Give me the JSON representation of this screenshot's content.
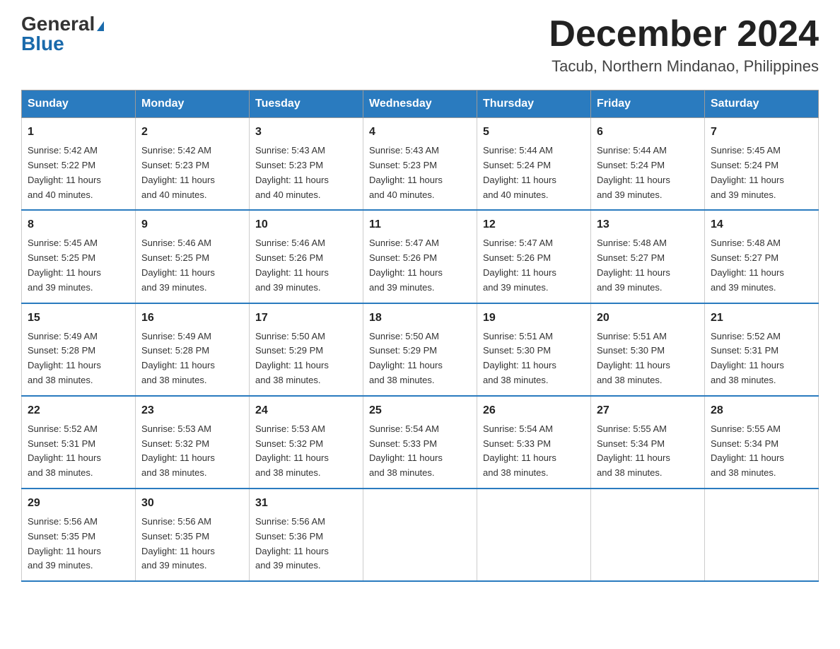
{
  "header": {
    "logo_general": "General",
    "logo_blue": "Blue",
    "month_title": "December 2024",
    "location": "Tacub, Northern Mindanao, Philippines"
  },
  "days_of_week": [
    "Sunday",
    "Monday",
    "Tuesday",
    "Wednesday",
    "Thursday",
    "Friday",
    "Saturday"
  ],
  "weeks": [
    [
      {
        "day": "1",
        "sunrise": "5:42 AM",
        "sunset": "5:22 PM",
        "daylight": "11 hours and 40 minutes."
      },
      {
        "day": "2",
        "sunrise": "5:42 AM",
        "sunset": "5:23 PM",
        "daylight": "11 hours and 40 minutes."
      },
      {
        "day": "3",
        "sunrise": "5:43 AM",
        "sunset": "5:23 PM",
        "daylight": "11 hours and 40 minutes."
      },
      {
        "day": "4",
        "sunrise": "5:43 AM",
        "sunset": "5:23 PM",
        "daylight": "11 hours and 40 minutes."
      },
      {
        "day": "5",
        "sunrise": "5:44 AM",
        "sunset": "5:24 PM",
        "daylight": "11 hours and 40 minutes."
      },
      {
        "day": "6",
        "sunrise": "5:44 AM",
        "sunset": "5:24 PM",
        "daylight": "11 hours and 39 minutes."
      },
      {
        "day": "7",
        "sunrise": "5:45 AM",
        "sunset": "5:24 PM",
        "daylight": "11 hours and 39 minutes."
      }
    ],
    [
      {
        "day": "8",
        "sunrise": "5:45 AM",
        "sunset": "5:25 PM",
        "daylight": "11 hours and 39 minutes."
      },
      {
        "day": "9",
        "sunrise": "5:46 AM",
        "sunset": "5:25 PM",
        "daylight": "11 hours and 39 minutes."
      },
      {
        "day": "10",
        "sunrise": "5:46 AM",
        "sunset": "5:26 PM",
        "daylight": "11 hours and 39 minutes."
      },
      {
        "day": "11",
        "sunrise": "5:47 AM",
        "sunset": "5:26 PM",
        "daylight": "11 hours and 39 minutes."
      },
      {
        "day": "12",
        "sunrise": "5:47 AM",
        "sunset": "5:26 PM",
        "daylight": "11 hours and 39 minutes."
      },
      {
        "day": "13",
        "sunrise": "5:48 AM",
        "sunset": "5:27 PM",
        "daylight": "11 hours and 39 minutes."
      },
      {
        "day": "14",
        "sunrise": "5:48 AM",
        "sunset": "5:27 PM",
        "daylight": "11 hours and 39 minutes."
      }
    ],
    [
      {
        "day": "15",
        "sunrise": "5:49 AM",
        "sunset": "5:28 PM",
        "daylight": "11 hours and 38 minutes."
      },
      {
        "day": "16",
        "sunrise": "5:49 AM",
        "sunset": "5:28 PM",
        "daylight": "11 hours and 38 minutes."
      },
      {
        "day": "17",
        "sunrise": "5:50 AM",
        "sunset": "5:29 PM",
        "daylight": "11 hours and 38 minutes."
      },
      {
        "day": "18",
        "sunrise": "5:50 AM",
        "sunset": "5:29 PM",
        "daylight": "11 hours and 38 minutes."
      },
      {
        "day": "19",
        "sunrise": "5:51 AM",
        "sunset": "5:30 PM",
        "daylight": "11 hours and 38 minutes."
      },
      {
        "day": "20",
        "sunrise": "5:51 AM",
        "sunset": "5:30 PM",
        "daylight": "11 hours and 38 minutes."
      },
      {
        "day": "21",
        "sunrise": "5:52 AM",
        "sunset": "5:31 PM",
        "daylight": "11 hours and 38 minutes."
      }
    ],
    [
      {
        "day": "22",
        "sunrise": "5:52 AM",
        "sunset": "5:31 PM",
        "daylight": "11 hours and 38 minutes."
      },
      {
        "day": "23",
        "sunrise": "5:53 AM",
        "sunset": "5:32 PM",
        "daylight": "11 hours and 38 minutes."
      },
      {
        "day": "24",
        "sunrise": "5:53 AM",
        "sunset": "5:32 PM",
        "daylight": "11 hours and 38 minutes."
      },
      {
        "day": "25",
        "sunrise": "5:54 AM",
        "sunset": "5:33 PM",
        "daylight": "11 hours and 38 minutes."
      },
      {
        "day": "26",
        "sunrise": "5:54 AM",
        "sunset": "5:33 PM",
        "daylight": "11 hours and 38 minutes."
      },
      {
        "day": "27",
        "sunrise": "5:55 AM",
        "sunset": "5:34 PM",
        "daylight": "11 hours and 38 minutes."
      },
      {
        "day": "28",
        "sunrise": "5:55 AM",
        "sunset": "5:34 PM",
        "daylight": "11 hours and 38 minutes."
      }
    ],
    [
      {
        "day": "29",
        "sunrise": "5:56 AM",
        "sunset": "5:35 PM",
        "daylight": "11 hours and 39 minutes."
      },
      {
        "day": "30",
        "sunrise": "5:56 AM",
        "sunset": "5:35 PM",
        "daylight": "11 hours and 39 minutes."
      },
      {
        "day": "31",
        "sunrise": "5:56 AM",
        "sunset": "5:36 PM",
        "daylight": "11 hours and 39 minutes."
      },
      null,
      null,
      null,
      null
    ]
  ],
  "labels": {
    "sunrise": "Sunrise:",
    "sunset": "Sunset:",
    "daylight": "Daylight:"
  }
}
